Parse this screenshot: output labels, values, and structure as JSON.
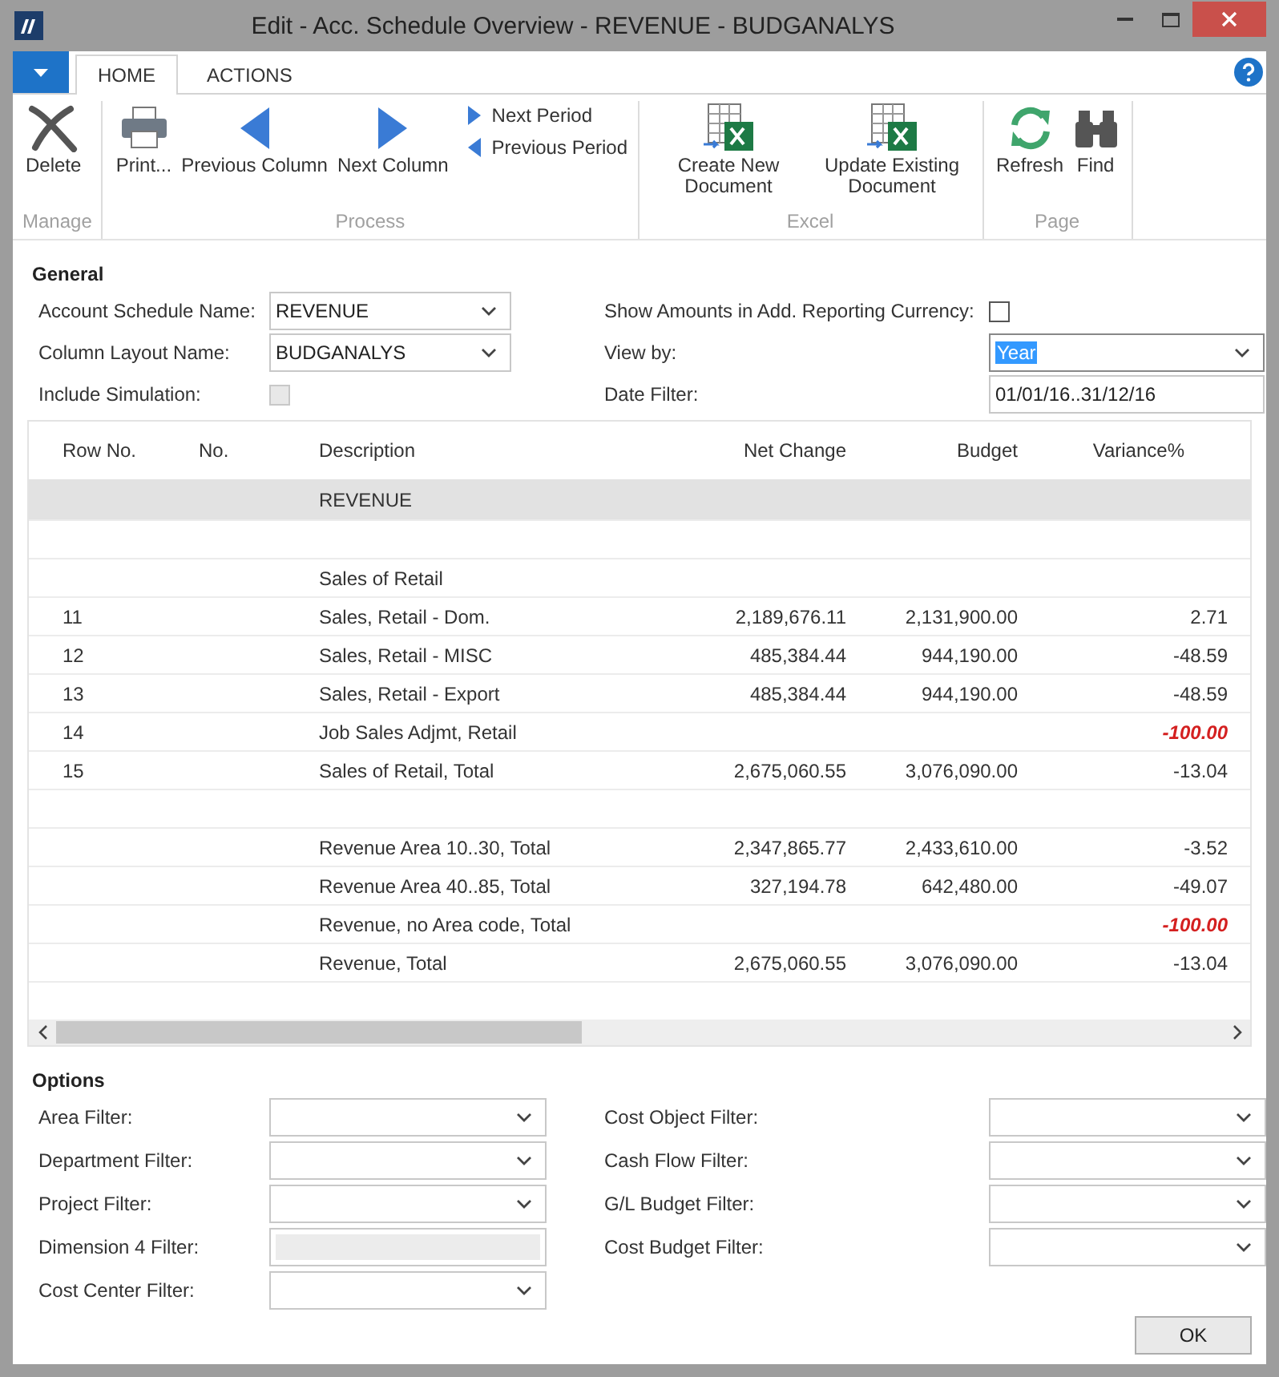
{
  "window": {
    "title": "Edit - Acc. Schedule Overview - REVENUE - BUDGANALYS"
  },
  "ribbon_tabs": [
    {
      "label": "HOME",
      "selected": true
    },
    {
      "label": "ACTIONS",
      "selected": false
    }
  ],
  "ribbon_groups": [
    {
      "label": "Manage",
      "buttons": [
        {
          "kind": "large",
          "label": "Delete"
        }
      ]
    },
    {
      "label": "Process",
      "buttons": [
        {
          "kind": "large",
          "label": "Print..."
        },
        {
          "kind": "large",
          "label": "Previous Column"
        },
        {
          "kind": "large",
          "label": "Next Column"
        },
        {
          "kind": "small",
          "label": "Next Period"
        },
        {
          "kind": "small",
          "label": "Previous Period"
        }
      ]
    },
    {
      "label": "Excel",
      "buttons": [
        {
          "kind": "large",
          "label": "Create New Document"
        },
        {
          "kind": "large",
          "label": "Update Existing Document"
        }
      ]
    },
    {
      "label": "Page",
      "buttons": [
        {
          "kind": "large",
          "label": "Refresh"
        },
        {
          "kind": "large",
          "label": "Find"
        }
      ]
    }
  ],
  "general": {
    "title": "General",
    "fields": [
      {
        "label": "Account Schedule Name:",
        "kind": "dropdown",
        "value": "REVENUE"
      },
      {
        "label": "Column Layout Name:",
        "kind": "dropdown",
        "value": "BUDGANALYS"
      },
      {
        "label": "Include Simulation:",
        "kind": "checkbox",
        "checked": false,
        "disabled": true
      },
      {
        "label": "Show Amounts in Add. Reporting Currency:",
        "kind": "checkbox",
        "checked": false,
        "disabled": false
      },
      {
        "label": "View by:",
        "kind": "dropdown",
        "value": "Year",
        "focused": true
      },
      {
        "label": "Date Filter:",
        "kind": "text",
        "value": "01/01/16..31/12/16"
      }
    ]
  },
  "table": {
    "columns": [
      "Row No.",
      "No.",
      "Description",
      "Net Change",
      "Budget",
      "Variance%"
    ],
    "rows": [
      {
        "selected": true,
        "description": "REVENUE"
      },
      {
        "selected": false
      },
      {
        "selected": false,
        "description": "Sales of Retail"
      },
      {
        "selected": false,
        "row_no": "11",
        "description": "Sales, Retail - Dom.",
        "net_change": "2,189,676.11",
        "budget": "2,131,900.00",
        "variance": "2.71",
        "emphasized": false
      },
      {
        "selected": false,
        "row_no": "12",
        "description": "Sales, Retail - MISC",
        "net_change": "485,384.44",
        "budget": "944,190.00",
        "variance": "-48.59",
        "emphasized": false
      },
      {
        "selected": false,
        "row_no": "13",
        "description": "Sales, Retail - Export",
        "net_change": "485,384.44",
        "budget": "944,190.00",
        "variance": "-48.59",
        "emphasized": false
      },
      {
        "selected": false,
        "row_no": "14",
        "description": "Job Sales Adjmt, Retail",
        "variance": "-100.00",
        "emphasized": true
      },
      {
        "selected": false,
        "row_no": "15",
        "description": "Sales of Retail, Total",
        "net_change": "2,675,060.55",
        "budget": "3,076,090.00",
        "variance": "-13.04",
        "emphasized": false
      },
      {
        "selected": false
      },
      {
        "selected": false,
        "description": "Revenue Area 10..30, Total",
        "net_change": "2,347,865.77",
        "budget": "2,433,610.00",
        "variance": "-3.52",
        "emphasized": false
      },
      {
        "selected": false,
        "description": "Revenue Area 40..85, Total",
        "net_change": "327,194.78",
        "budget": "642,480.00",
        "variance": "-49.07",
        "emphasized": false
      },
      {
        "selected": false,
        "description": "Revenue, no Area code, Total",
        "variance": "-100.00",
        "emphasized": true
      },
      {
        "selected": false,
        "description": "Revenue, Total",
        "net_change": "2,675,060.55",
        "budget": "3,076,090.00",
        "variance": "-13.04",
        "emphasized": false
      }
    ]
  },
  "options": {
    "title": "Options",
    "left": [
      {
        "label": "Area Filter:",
        "kind": "dropdown"
      },
      {
        "label": "Department Filter:",
        "kind": "dropdown"
      },
      {
        "label": "Project Filter:",
        "kind": "dropdown"
      },
      {
        "label": "Dimension 4 Filter:",
        "kind": "disabled"
      },
      {
        "label": "Cost Center Filter:",
        "kind": "dropdown"
      }
    ],
    "right": [
      {
        "label": "Cost Object Filter:",
        "kind": "dropdown"
      },
      {
        "label": "Cash Flow Filter:",
        "kind": "dropdown"
      },
      {
        "label": "G/L Budget Filter:",
        "kind": "dropdown"
      },
      {
        "label": "Cost Budget Filter:",
        "kind": "dropdown"
      }
    ]
  },
  "buttons": [
    "OK"
  ]
}
